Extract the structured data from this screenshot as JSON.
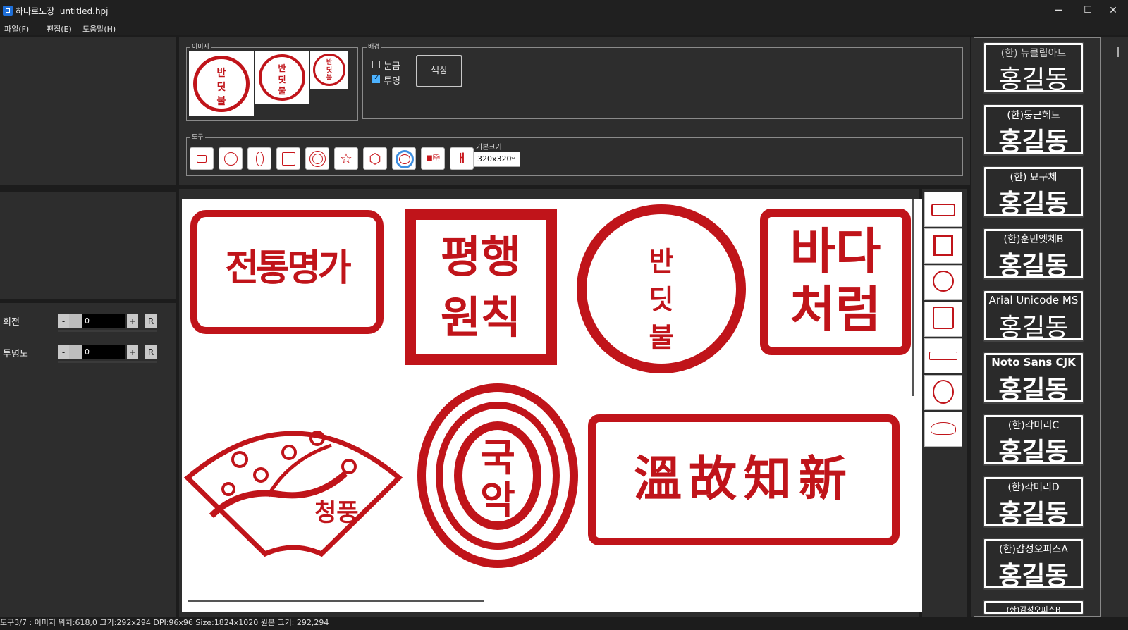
{
  "window": {
    "app_name": "하나로도장",
    "file_name": "untitled.hpj",
    "minimize": "─",
    "maximize": "☐",
    "close": "✕"
  },
  "menu": [
    {
      "label": "파일(F)"
    },
    {
      "label": "편집(E)"
    },
    {
      "label": "도움말(H)"
    }
  ],
  "image_group": {
    "label": "이미지"
  },
  "background_group": {
    "label": "배경",
    "grid_label": "눈금",
    "grid_checked": false,
    "transparent_label": "투명",
    "transparent_checked": true,
    "color_button": "색상"
  },
  "tool_group": {
    "label": "도구",
    "tools": [
      "text-tool",
      "circle-tool",
      "ellipse-tool",
      "square-tool",
      "double-circle-tool",
      "star-tool",
      "hexagon-tool",
      "image-tool",
      "symbol-tool",
      "special-char-tool"
    ],
    "default_size_label": "기본크기",
    "default_size_value": "320x320"
  },
  "properties": {
    "rotation_label": "회전",
    "rotation_value": "0",
    "opacity_label": "투명도",
    "opacity_value": "0",
    "minus": "-",
    "plus": "+",
    "reset": "R"
  },
  "canvas_seals": [
    {
      "text": "전통명가"
    },
    {
      "text": "평행원칙"
    },
    {
      "text": "반딧불"
    },
    {
      "text": "바다처럼"
    },
    {
      "text": "청풍"
    },
    {
      "text": "국악"
    },
    {
      "text": "溫故知新"
    }
  ],
  "thumbnail_seal_texts": [
    "반딧불",
    "반딧불",
    "반딧불"
  ],
  "font_list": [
    {
      "name": "(한) 뉴클립아트",
      "sample": "홍길동"
    },
    {
      "name": "(한)둥근헤드",
      "sample": "홍길동"
    },
    {
      "name": "(한) 묘구체",
      "sample": "홍길동"
    },
    {
      "name": "(한)훈민엣체B",
      "sample": "홍길동"
    },
    {
      "name": "Arial Unicode MS",
      "sample": "홍길동"
    },
    {
      "name": "Noto Sans CJK",
      "sample": "홍길동"
    },
    {
      "name": "(한)각머리C",
      "sample": "홍길동"
    },
    {
      "name": "(한)각머리D",
      "sample": "홍길동"
    },
    {
      "name": "(한)감성오피스A",
      "sample": "홍길동"
    },
    {
      "name": "(한)감성오피스B",
      "sample": ""
    }
  ],
  "status": {
    "text": "도구3/7 : 이미지 위치:618,0 크기:292x294 DPI:96x96 Size:1824x1020 원본 크기: 292,294"
  },
  "colors": {
    "seal_red": "#c0141a",
    "accent_blue": "#4db3ff",
    "panel": "#2d2d2d",
    "background": "#1c1c1c"
  }
}
